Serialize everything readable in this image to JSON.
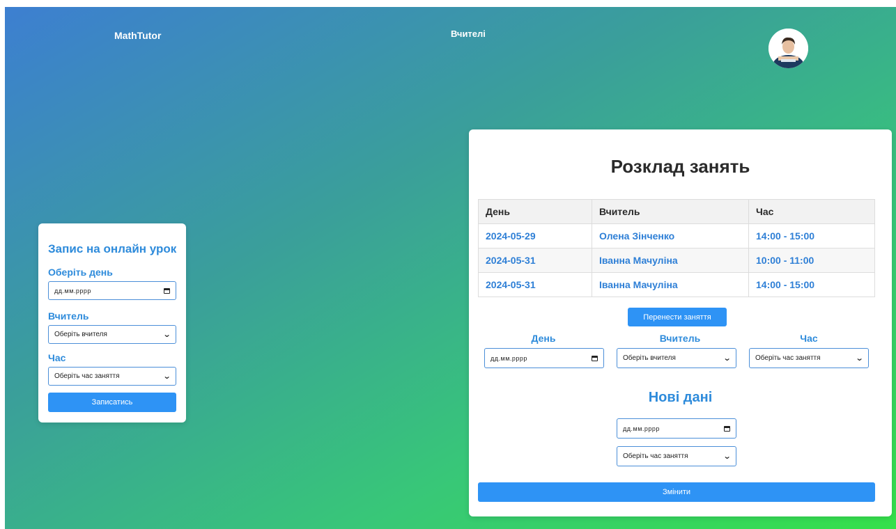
{
  "header": {
    "brand": "MathTutor",
    "nav_teachers": "Вчителі"
  },
  "booking": {
    "title": "Запис на онлайн урок",
    "day_label": "Оберіть день",
    "date_placeholder": "дд.мм.рррр",
    "teacher_label": "Вчитель",
    "teacher_select": "Оберіть вчителя",
    "time_label": "Час",
    "time_select": "Оберіть час заняття",
    "submit": "Записатись"
  },
  "schedule": {
    "title": "Розклад занять",
    "columns": [
      "День",
      "Вчитель",
      "Час"
    ],
    "rows": [
      [
        "2024-05-29",
        "Олена Зінченко",
        "14:00 - 15:00"
      ],
      [
        "2024-05-31",
        "Іванна Мачуліна",
        "10:00 - 11:00"
      ],
      [
        "2024-05-31",
        "Іванна Мачуліна",
        "14:00 - 15:00"
      ]
    ],
    "reschedule_button": "Перенести заняття",
    "day_label": "День",
    "teacher_label": "Вчитель",
    "time_label": "Час",
    "date_placeholder": "дд.мм.рррр",
    "teacher_select": "Оберіть вчителя",
    "time_select": "Оберіть час заняття",
    "new_data_title": "Нові дані",
    "new_date_placeholder": "дд.мм.рррр",
    "new_time_select": "Оберіть час заняття",
    "change_button": "Змінити"
  },
  "colors": {
    "accent": "#2e93f5",
    "label_blue": "#2e8bdb",
    "gradient_start": "#3d7fd1",
    "gradient_end": "#35e04a"
  },
  "icons": {
    "calendar": "calendar-icon",
    "chevron": "chevron-down-icon"
  }
}
